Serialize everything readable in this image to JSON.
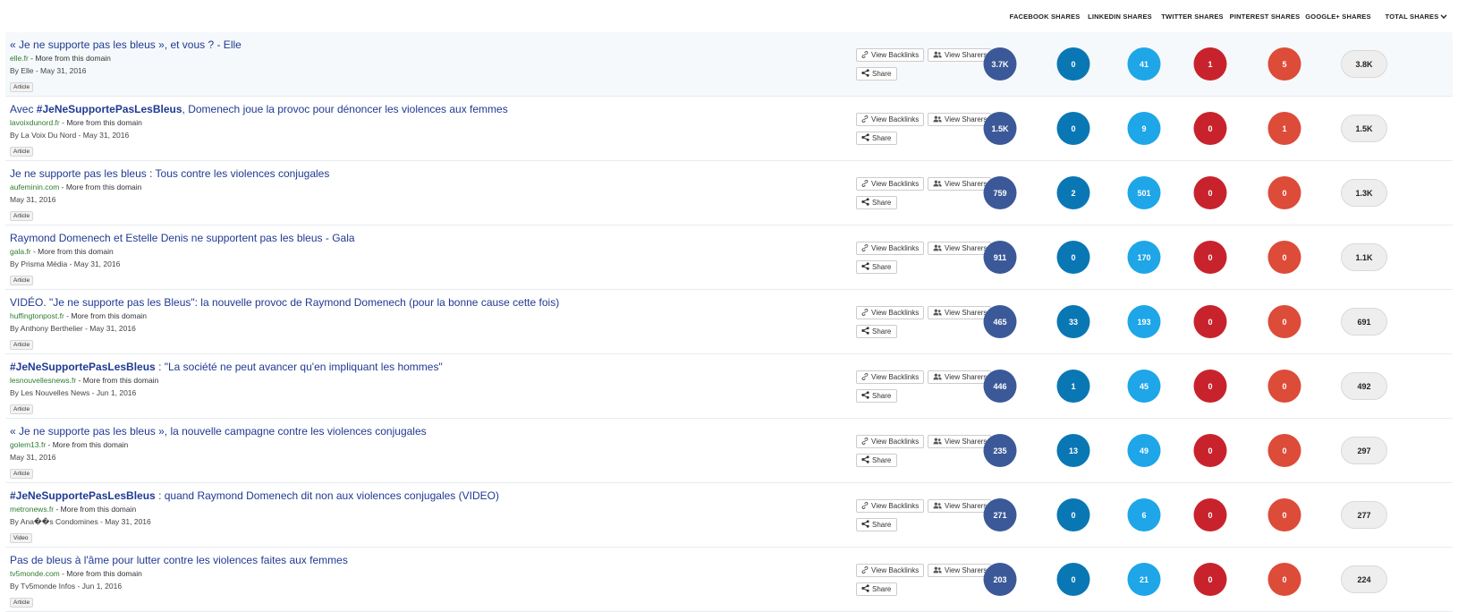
{
  "columns": {
    "facebook": "FACEBOOK SHARES",
    "linkedin": "LINKEDIN SHARES",
    "twitter": "TWITTER SHARES",
    "pinterest": "PINTEREST SHARES",
    "googleplus": "GOOGLE+ SHARES",
    "total": "TOTAL SHARES"
  },
  "colors": {
    "facebook": "#3b5998",
    "linkedin": "#0a77b5",
    "twitter": "#1ea6e8",
    "pinterest": "#c8232c",
    "googleplus": "#dd4b39"
  },
  "icons": {
    "backlinks": "link-icon",
    "sharers": "users-icon",
    "share": "share-icon",
    "sort": "chevron-down-icon"
  },
  "labels": {
    "view_backlinks": "View Backlinks",
    "view_sharers": "View Sharers",
    "share": "Share",
    "more_from_domain": " - More from this domain"
  },
  "rows": [
    {
      "title_html": "« Je ne supporte pas les bleus », et vous ? - Elle",
      "domain": "elle.fr",
      "byline": "By Elle - May 31, 2016",
      "type": "Article",
      "facebook": "3.7K",
      "linkedin": "0",
      "twitter": "41",
      "pinterest": "1",
      "googleplus": "5",
      "total": "3.8K"
    },
    {
      "title_html": "Avec <b>#JeNeSupportePasLesBleus</b>, Domenech joue la provoc pour dénoncer les violences aux femmes",
      "domain": "lavoixdunord.fr",
      "byline": "By La Voix Du Nord - May 31, 2016",
      "type": "Article",
      "facebook": "1.5K",
      "linkedin": "0",
      "twitter": "9",
      "pinterest": "0",
      "googleplus": "1",
      "total": "1.5K"
    },
    {
      "title_html": "Je ne supporte pas les bleus : Tous contre les violences conjugales",
      "domain": "aufeminin.com",
      "byline": "May 31, 2016",
      "type": "Article",
      "facebook": "759",
      "linkedin": "2",
      "twitter": "501",
      "pinterest": "0",
      "googleplus": "0",
      "total": "1.3K"
    },
    {
      "title_html": "Raymond Domenech et Estelle Denis ne supportent pas les bleus - Gala",
      "domain": "gala.fr",
      "byline": "By Prisma Média - May 31, 2016",
      "type": "Article",
      "facebook": "911",
      "linkedin": "0",
      "twitter": "170",
      "pinterest": "0",
      "googleplus": "0",
      "total": "1.1K"
    },
    {
      "title_html": "VIDÉO. \"Je ne supporte pas les Bleus\": la nouvelle provoc de Raymond Domenech (pour la bonne cause cette fois)",
      "domain": "huffingtonpost.fr",
      "byline": "By Anthony Berthelier - May 31, 2016",
      "type": "Article",
      "facebook": "465",
      "linkedin": "33",
      "twitter": "193",
      "pinterest": "0",
      "googleplus": "0",
      "total": "691"
    },
    {
      "title_html": "<b>#JeNeSupportePasLesBleus</b> : \"La société ne peut avancer qu'en impliquant les hommes\"",
      "domain": "lesnouvellesnews.fr",
      "byline": "By Les Nouvelles News - Jun 1, 2016",
      "type": "Article",
      "facebook": "446",
      "linkedin": "1",
      "twitter": "45",
      "pinterest": "0",
      "googleplus": "0",
      "total": "492"
    },
    {
      "title_html": "« Je ne supporte pas les bleus », la nouvelle campagne contre les violences conjugales",
      "domain": "golem13.fr",
      "byline": "May 31, 2016",
      "type": "Article",
      "facebook": "235",
      "linkedin": "13",
      "twitter": "49",
      "pinterest": "0",
      "googleplus": "0",
      "total": "297"
    },
    {
      "title_html": "<b>#JeNeSupportePasLesBleus</b> : quand Raymond Domenech dit non aux violences conjugales (VIDEO)",
      "domain": "metronews.fr",
      "byline": "By Ana��s Condomines - May 31, 2016",
      "type": "Video",
      "facebook": "271",
      "linkedin": "0",
      "twitter": "6",
      "pinterest": "0",
      "googleplus": "0",
      "total": "277"
    },
    {
      "title_html": "Pas de bleus à l'âme pour lutter contre les violences faites aux femmes",
      "domain": "tv5monde.com",
      "byline": "By Tv5monde Infos - Jun 1, 2016",
      "type": "Article",
      "facebook": "203",
      "linkedin": "0",
      "twitter": "21",
      "pinterest": "0",
      "googleplus": "0",
      "total": "224"
    }
  ]
}
